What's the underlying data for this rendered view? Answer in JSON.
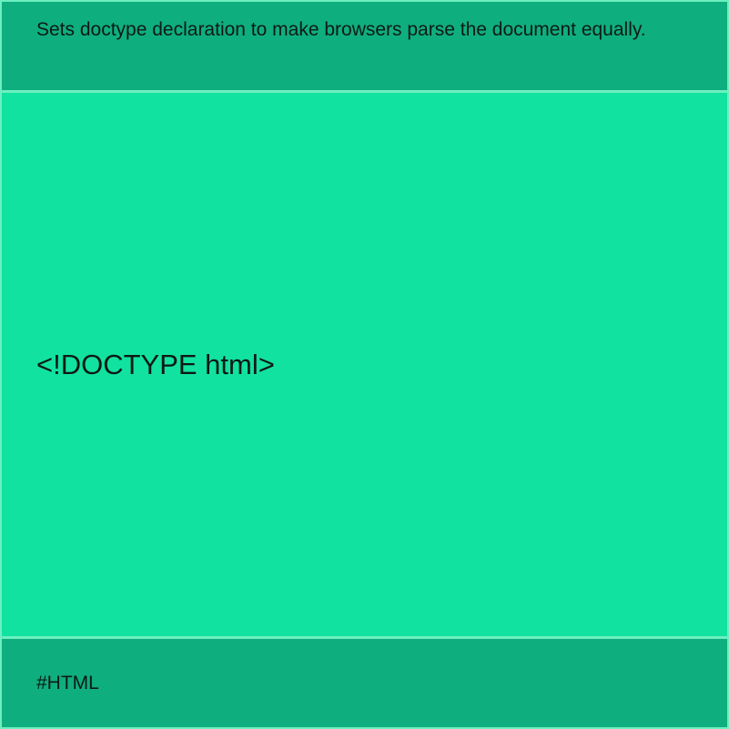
{
  "card": {
    "description": "Sets doctype declaration to make browsers parse the document equally.",
    "code": "<!DOCTYPE html>",
    "tag": "#HTML"
  },
  "colors": {
    "header": "#0fae7e",
    "main": "#12e29f",
    "border": "#6cefc0"
  }
}
